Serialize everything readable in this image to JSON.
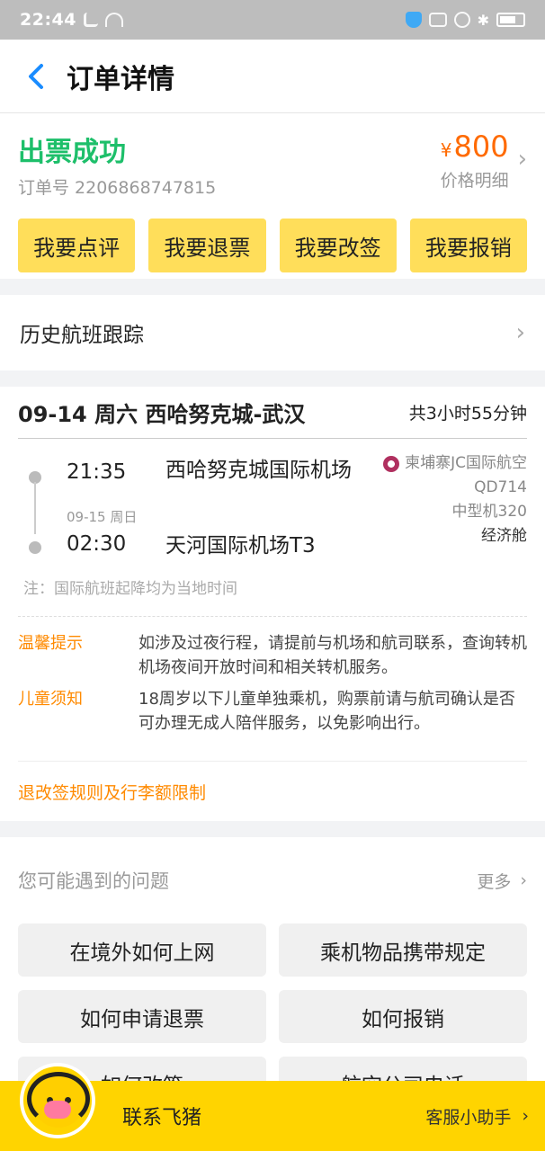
{
  "status_bar": {
    "time": "22:44"
  },
  "nav": {
    "title": "订单详情"
  },
  "order": {
    "status": "出票成功",
    "order_label": "订单号 2206868747815",
    "price_symbol": "¥",
    "price": "800",
    "price_detail": "价格明细",
    "actions": [
      "我要点评",
      "我要退票",
      "我要改签",
      "我要报销"
    ]
  },
  "history": {
    "label": "历史航班跟踪"
  },
  "flight": {
    "route": "09-14 周六 西哈努克城-武汉",
    "duration": "共3小时55分钟",
    "dep_time": "21:35",
    "dep_airport": "西哈努克城国际机场",
    "arr_date": "09-15 周日",
    "arr_time": "02:30",
    "arr_airport": "天河国际机场T3",
    "airline": "柬埔寨JC国际航空",
    "flight_no": "QD714",
    "aircraft": "中型机320",
    "cabin": "经济舱",
    "note": "注：国际航班起降均为当地时间"
  },
  "tips": [
    {
      "label": "温馨提示",
      "text": "如涉及过夜行程，请提前与机场和航司联系，查询转机机场夜间开放时间和相关转机服务。"
    },
    {
      "label": "儿童须知",
      "text": "18周岁以下儿童单独乘机，购票前请与航司确认是否可办理无成人陪伴服务，以免影响出行。"
    }
  ],
  "rules": {
    "label": "退改签规则及行李额限制"
  },
  "faq": {
    "title": "您可能遇到的问题",
    "more": "更多",
    "items": [
      "在境外如何上网",
      "乘机物品携带规定",
      "如何申请退票",
      "如何报销",
      "如何改签",
      "航空公司电话"
    ]
  },
  "bottom": {
    "contact": "联系飞猪",
    "assistant": "客服小助手"
  },
  "colors": {
    "accent_yellow": "#ffd400",
    "success_green": "#1dbf6a",
    "price_orange": "#ff6a00",
    "link_blue": "#1a8cff"
  }
}
